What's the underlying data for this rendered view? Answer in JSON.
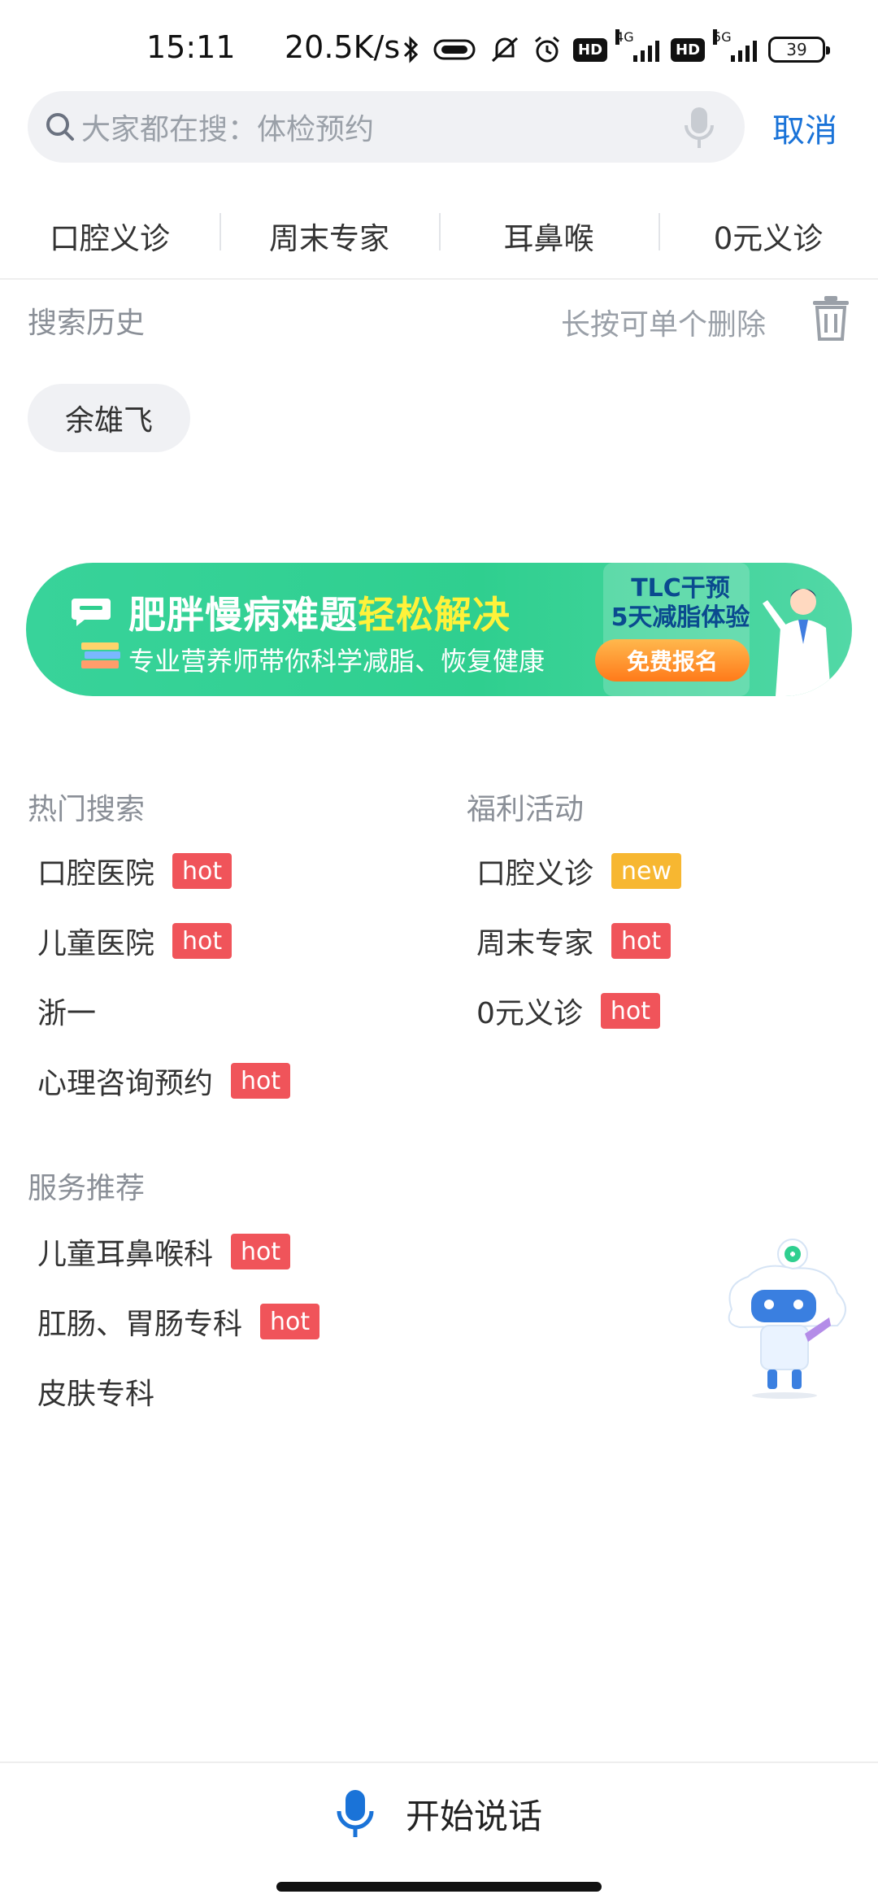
{
  "status_bar": {
    "time": "15:11",
    "speed": "20.5K/s",
    "battery": "39",
    "net_4g": "4G",
    "net_5g": "5G",
    "hd_1": "HD",
    "hd_2": "HD"
  },
  "search": {
    "placeholder": "大家都在搜：体检预约",
    "cancel_label": "取消"
  },
  "quick_tabs": [
    "口腔义诊",
    "周末专家",
    "耳鼻喉",
    "0元义诊"
  ],
  "history": {
    "title": "搜索历史",
    "hint": "长按可单个删除",
    "items": [
      "余雄飞"
    ]
  },
  "banner": {
    "title_main": "肥胖慢病难题",
    "title_highlight": "轻松解决",
    "subtitle": "专业营养师带你科学减脂、恢复健康",
    "tag_line1": "TLC干预",
    "tag_line2": "5天减脂体验",
    "cta": "免费报名"
  },
  "hot_search": {
    "title": "热门搜索",
    "items": [
      {
        "label": "口腔医院",
        "badge": "hot"
      },
      {
        "label": "儿童医院",
        "badge": "hot"
      },
      {
        "label": "浙一",
        "badge": ""
      },
      {
        "label": "心理咨询预约",
        "badge": "hot"
      }
    ]
  },
  "welfare": {
    "title": "福利活动",
    "items": [
      {
        "label": "口腔义诊",
        "badge": "new"
      },
      {
        "label": "周末专家",
        "badge": "hot"
      },
      {
        "label": "0元义诊",
        "badge": "hot"
      }
    ]
  },
  "services": {
    "title": "服务推荐",
    "items": [
      {
        "label": "儿童耳鼻喉科",
        "badge": "hot"
      },
      {
        "label": "肛肠、胃肠专科",
        "badge": "hot"
      },
      {
        "label": "皮肤专科",
        "badge": ""
      }
    ]
  },
  "voice": {
    "label": "开始说话"
  },
  "colors": {
    "accent_blue": "#1a73d8",
    "hot_red": "#f0545a",
    "new_yellow": "#f7b731",
    "banner_green": "#2fcf8f"
  }
}
